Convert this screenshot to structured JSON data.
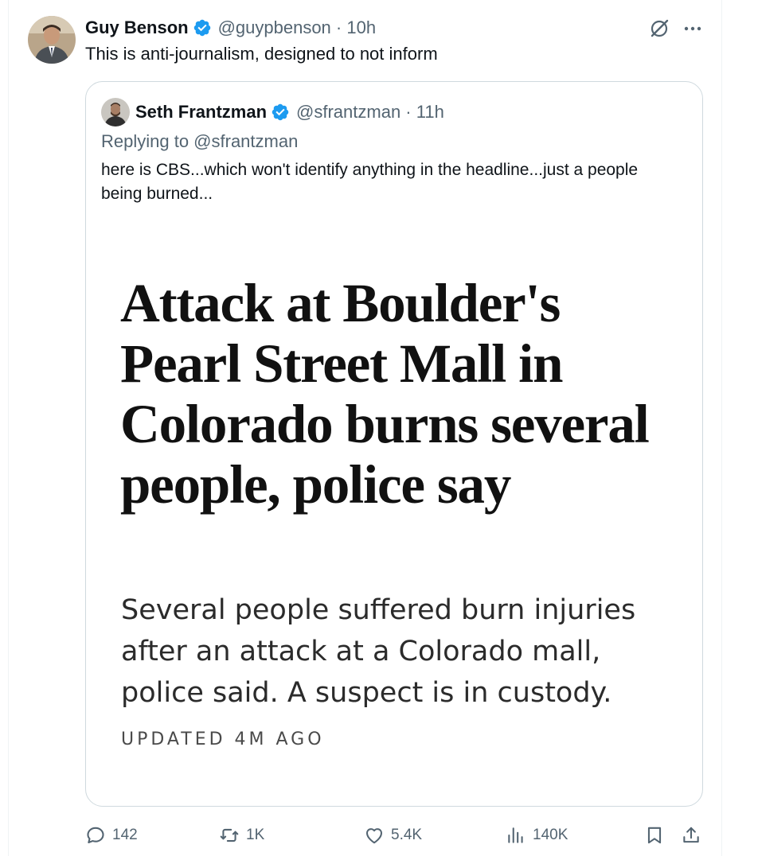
{
  "tweet": {
    "author_name": "Guy Benson",
    "handle_time": "@guypbenson · 10h",
    "text": "This is anti-journalism, designed to not inform"
  },
  "quote": {
    "author_name": "Seth Frantzman",
    "handle_time": "@sfrantzman · 11h",
    "replying_to": "Replying to @sfrantzman",
    "text": "here is CBS...which won't identify anything in the headline...just a people being burned...",
    "article": {
      "headline": "Attack at Boulder's Pearl Street Mall in Colorado burns several people, police say",
      "dek": "Several people suffered burn injuries after an attack at a Colorado mall, police said. A suspect is in custody.",
      "updated": "UPDATED 4M AGO"
    }
  },
  "actions": {
    "replies": "142",
    "reposts": "1K",
    "likes": "5.4K",
    "views": "140K"
  },
  "colors": {
    "verified_blue": "#1d9bf0",
    "muted_text": "#536471",
    "border": "#cfd9de"
  },
  "icons": [
    "verified-badge-icon",
    "grok-icon",
    "more-icon",
    "reply-icon",
    "repost-icon",
    "like-icon",
    "views-icon",
    "bookmark-icon",
    "share-icon"
  ]
}
